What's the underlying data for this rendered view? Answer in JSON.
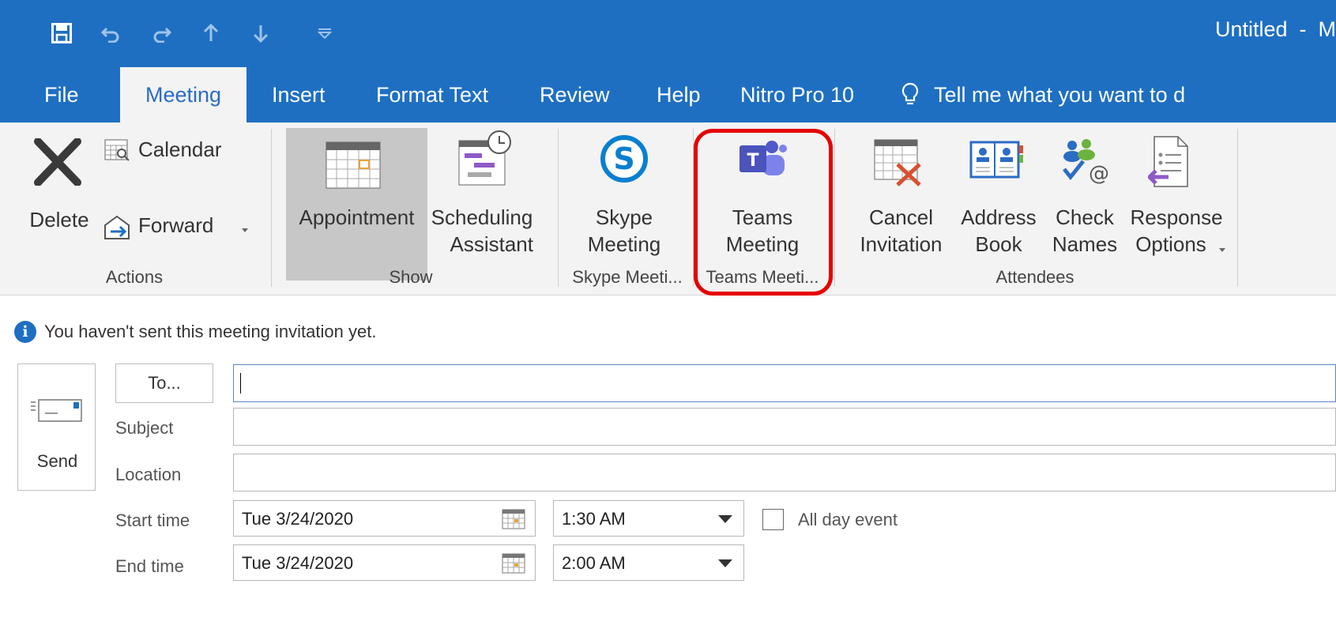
{
  "window": {
    "title": "Untitled  -  M"
  },
  "quick_access": [
    "save-icon",
    "undo-icon",
    "redo-icon",
    "up-arrow-icon",
    "down-arrow-icon",
    "customize-dropdown-icon"
  ],
  "tabs": [
    {
      "label": "File"
    },
    {
      "label": "Meeting"
    },
    {
      "label": "Insert"
    },
    {
      "label": "Format Text"
    },
    {
      "label": "Review"
    },
    {
      "label": "Help"
    },
    {
      "label": "Nitro Pro 10"
    }
  ],
  "tell_me": "Tell me what you want to d",
  "ribbon": {
    "actions": {
      "delete": "Delete",
      "calendar": "Calendar",
      "forward": "Forward",
      "group": "Actions"
    },
    "show": {
      "appointment": "Appointment",
      "scheduling_line1": "Scheduling",
      "scheduling_line2": "Assistant",
      "group": "Show"
    },
    "skype": {
      "line1": "Skype",
      "line2": "Meeting",
      "group": "Skype Meeti..."
    },
    "teams": {
      "line1": "Teams",
      "line2": "Meeting",
      "group": "Teams Meeti..."
    },
    "attendees": {
      "cancel_line1": "Cancel",
      "cancel_line2": "Invitation",
      "address_line1": "Address",
      "address_line2": "Book",
      "check_line1": "Check",
      "check_line2": "Names",
      "response_line1": "Response",
      "response_line2": "Options",
      "group": "Attendees"
    }
  },
  "info_message": "You haven't sent this meeting invitation yet.",
  "form": {
    "send": "Send",
    "to_button": "To...",
    "to_value": "",
    "subject_label": "Subject",
    "subject_value": "",
    "location_label": "Location",
    "location_value": "",
    "start_label": "Start time",
    "start_date": "Tue 3/24/2020",
    "start_time": "1:30 AM",
    "end_label": "End time",
    "end_date": "Tue 3/24/2020",
    "end_time": "2:00 AM",
    "all_day_label": "All day event",
    "all_day_checked": false
  },
  "colors": {
    "title_bar": "#1e6fc2",
    "highlight": "#e50000",
    "teams_purple": "#5059c9"
  }
}
